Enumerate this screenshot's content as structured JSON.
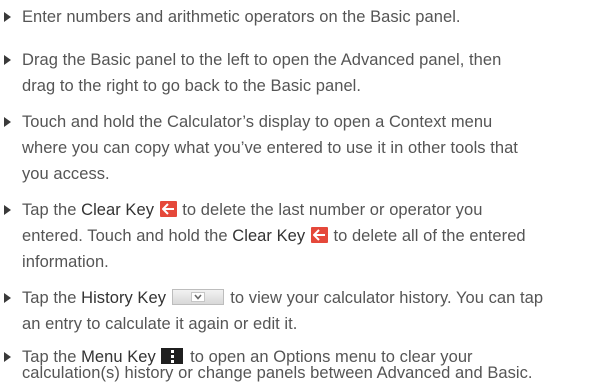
{
  "instructions": {
    "items": [
      {
        "lines": [
          "Enter numbers and arithmetic operators on the Basic panel."
        ]
      },
      {
        "lines": [
          "Drag the Basic panel to the left to open the Advanced panel, then",
          "drag to the right to go back to the Basic panel."
        ]
      },
      {
        "lines": [
          "Touch and hold the Calculator’s display to open a Context menu",
          "where you can copy what you’ve entered to use it in other tools that",
          "you access."
        ]
      },
      {
        "line1_pre": "Tap the ",
        "line1_key": "Clear Key",
        "line1_post": " to delete the last number or operator you",
        "line2_pre": "entered. Touch and hold the ",
        "line2_key": "Clear Key",
        "line2_post": " to delete all of the entered",
        "line3": "information.",
        "icon": "clear-key-arrow-icon",
        "icon_color": "#e5483a"
      },
      {
        "line1_pre": "Tap the ",
        "line1_key": "History Key",
        "line1_post": " to view your calculator history. You can tap",
        "line2": "an entry to calculate it again or edit it.",
        "icon": "history-key-chevron-icon"
      },
      {
        "line1_pre": "Tap the ",
        "line1_key": "Menu Key",
        "line1_post": " to open an Options menu to clear your",
        "line2": "calculation(s) history or change panels between Advanced and Basic.",
        "icon": "menu-key-dots-icon"
      }
    ]
  }
}
